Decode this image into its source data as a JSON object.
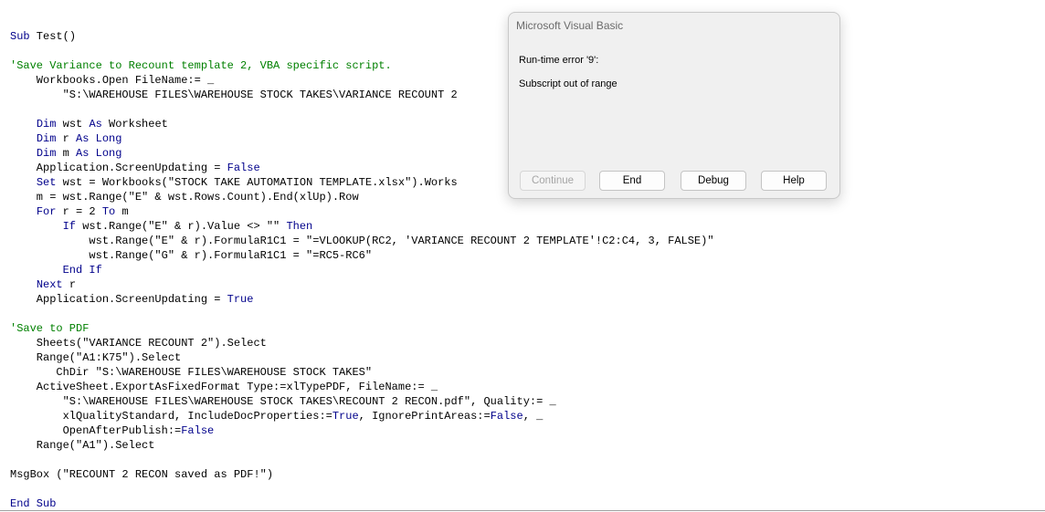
{
  "dialog": {
    "title": "Microsoft Visual Basic",
    "message_line1": "Run-time error '9':",
    "message_line2": "Subscript out of range",
    "buttons": {
      "continue": "Continue",
      "end": "End",
      "debug": "Debug",
      "help": "Help"
    }
  },
  "code": {
    "lines": [
      [
        [
          "kw",
          "Sub"
        ],
        [
          "n",
          " Test()"
        ]
      ],
      [
        [
          "n",
          ""
        ]
      ],
      [
        [
          "cm",
          "'Save Variance to Recount template 2, VBA specific script."
        ]
      ],
      [
        [
          "n",
          "    Workbooks.Open FileName:= _"
        ]
      ],
      [
        [
          "n",
          "        \"S:\\WAREHOUSE FILES\\WAREHOUSE STOCK TAKES\\VARIANCE RECOUNT 2"
        ]
      ],
      [
        [
          "n",
          ""
        ]
      ],
      [
        [
          "n",
          "    "
        ],
        [
          "kw",
          "Dim"
        ],
        [
          "n",
          " wst "
        ],
        [
          "kw",
          "As"
        ],
        [
          "n",
          " Worksheet"
        ]
      ],
      [
        [
          "n",
          "    "
        ],
        [
          "kw",
          "Dim"
        ],
        [
          "n",
          " r "
        ],
        [
          "kw",
          "As"
        ],
        [
          "n",
          " "
        ],
        [
          "kw",
          "Long"
        ]
      ],
      [
        [
          "n",
          "    "
        ],
        [
          "kw",
          "Dim"
        ],
        [
          "n",
          " m "
        ],
        [
          "kw",
          "As"
        ],
        [
          "n",
          " "
        ],
        [
          "kw",
          "Long"
        ]
      ],
      [
        [
          "n",
          "    Application.ScreenUpdating = "
        ],
        [
          "kw",
          "False"
        ]
      ],
      [
        [
          "n",
          "    "
        ],
        [
          "kw",
          "Set"
        ],
        [
          "n",
          " wst = Workbooks(\"STOCK TAKE AUTOMATION TEMPLATE.xlsx\").Works"
        ]
      ],
      [
        [
          "n",
          "    m = wst.Range(\"E\" & wst.Rows.Count).End(xlUp).Row"
        ]
      ],
      [
        [
          "n",
          "    "
        ],
        [
          "kw",
          "For"
        ],
        [
          "n",
          " r = 2 "
        ],
        [
          "kw",
          "To"
        ],
        [
          "n",
          " m"
        ]
      ],
      [
        [
          "n",
          "        "
        ],
        [
          "kw",
          "If"
        ],
        [
          "n",
          " wst.Range(\"E\" & r).Value <> \"\" "
        ],
        [
          "kw",
          "Then"
        ]
      ],
      [
        [
          "n",
          "            wst.Range(\"E\" & r).FormulaR1C1 = \"=VLOOKUP(RC2, 'VARIANCE RECOUNT 2 TEMPLATE'!C2:C4, 3, FALSE)\""
        ]
      ],
      [
        [
          "n",
          "            wst.Range(\"G\" & r).FormulaR1C1 = \"=RC5-RC6\""
        ]
      ],
      [
        [
          "n",
          "        "
        ],
        [
          "kw",
          "End If"
        ]
      ],
      [
        [
          "n",
          "    "
        ],
        [
          "kw",
          "Next"
        ],
        [
          "n",
          " r"
        ]
      ],
      [
        [
          "n",
          "    Application.ScreenUpdating = "
        ],
        [
          "kw",
          "True"
        ]
      ],
      [
        [
          "n",
          ""
        ]
      ],
      [
        [
          "cm",
          "'Save to PDF"
        ]
      ],
      [
        [
          "n",
          "    Sheets(\"VARIANCE RECOUNT 2\").Select"
        ]
      ],
      [
        [
          "n",
          "    Range(\"A1:K75\").Select"
        ]
      ],
      [
        [
          "n",
          "       ChDir \"S:\\WAREHOUSE FILES\\WAREHOUSE STOCK TAKES\""
        ]
      ],
      [
        [
          "n",
          "    ActiveSheet.ExportAsFixedFormat Type:=xlTypePDF, FileName:= _"
        ]
      ],
      [
        [
          "n",
          "        \"S:\\WAREHOUSE FILES\\WAREHOUSE STOCK TAKES\\RECOUNT 2 RECON.pdf\", Quality:= _"
        ]
      ],
      [
        [
          "n",
          "        xlQualityStandard, IncludeDocProperties:="
        ],
        [
          "kw",
          "True"
        ],
        [
          "n",
          ", IgnorePrintAreas:="
        ],
        [
          "kw",
          "False"
        ],
        [
          "n",
          ", _"
        ]
      ],
      [
        [
          "n",
          "        OpenAfterPublish:="
        ],
        [
          "kw",
          "False"
        ]
      ],
      [
        [
          "n",
          "    Range(\"A1\").Select"
        ]
      ],
      [
        [
          "n",
          ""
        ]
      ],
      [
        [
          "n",
          "MsgBox (\"RECOUNT 2 RECON saved as PDF!\")"
        ]
      ],
      [
        [
          "n",
          ""
        ]
      ],
      [
        [
          "kw",
          "End Sub"
        ]
      ]
    ]
  }
}
